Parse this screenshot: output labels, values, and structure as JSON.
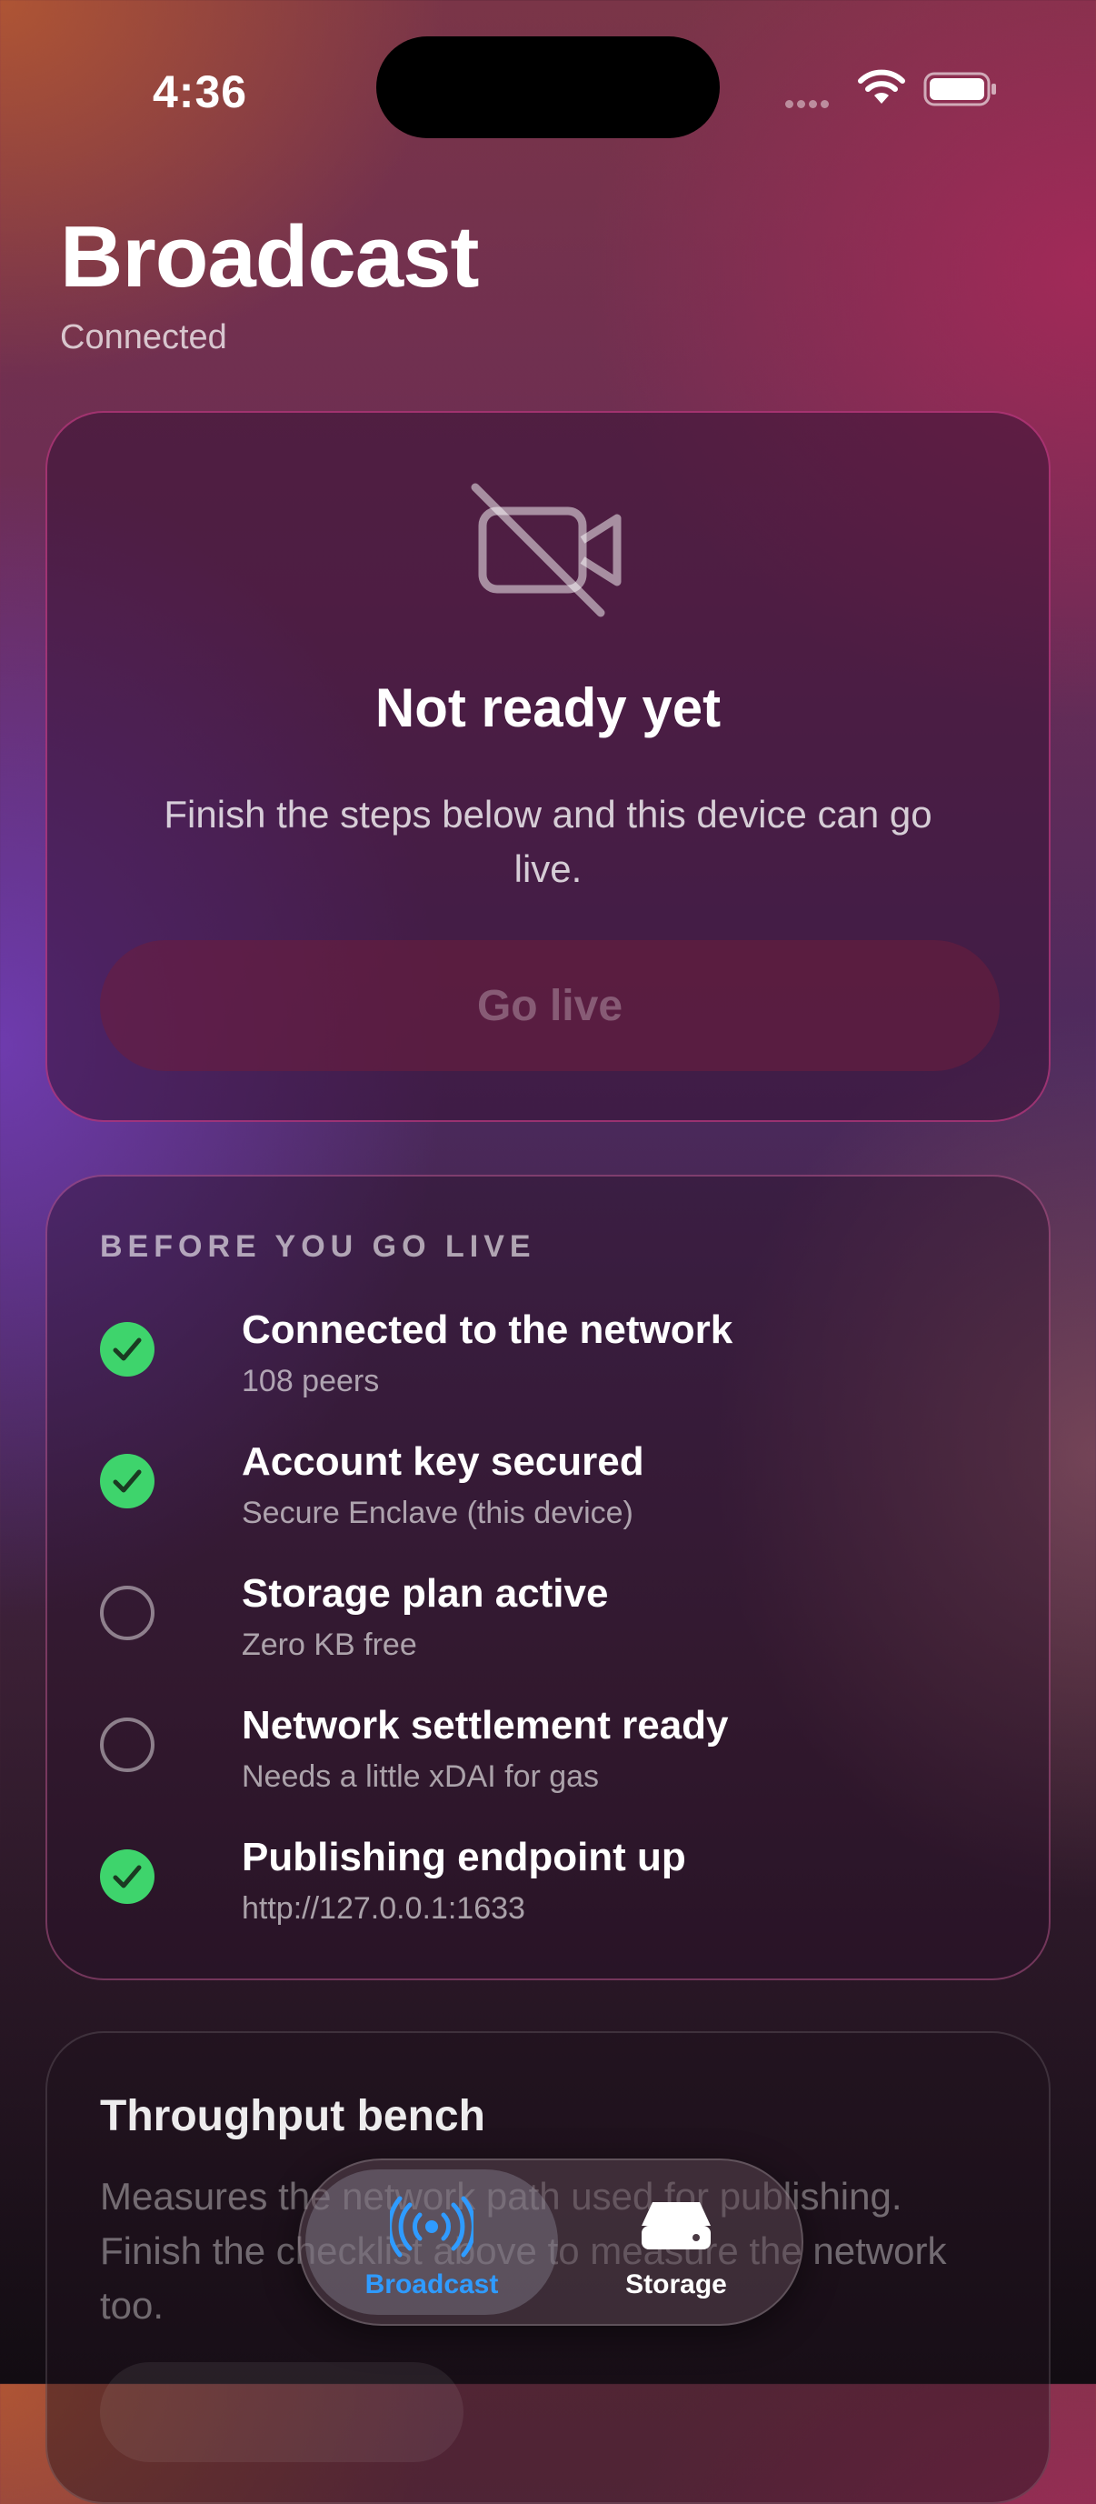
{
  "status_bar": {
    "time": "4:36"
  },
  "header": {
    "title": "Broadcast",
    "status": "Connected"
  },
  "hero": {
    "icon": "video-off-icon",
    "title": "Not ready yet",
    "description": "Finish the steps below and this device can go live.",
    "button_label": "Go live"
  },
  "checklist": {
    "section_label": "BEFORE YOU GO LIVE",
    "items": [
      {
        "title": "Connected to the network",
        "subtitle": "108 peers",
        "done": true
      },
      {
        "title": "Account key secured",
        "subtitle": "Secure Enclave (this device)",
        "done": true
      },
      {
        "title": "Storage plan active",
        "subtitle": "Zero KB free",
        "done": false
      },
      {
        "title": "Network settlement ready",
        "subtitle": "Needs a little xDAI for gas",
        "done": false
      },
      {
        "title": "Publishing endpoint up",
        "subtitle": "http://127.0.0.1:1633",
        "done": true
      }
    ]
  },
  "bench": {
    "title": "Throughput bench",
    "description": "Measures the network path used for publishing. Finish the checklist above to measure the network too."
  },
  "tabbar": {
    "tabs": [
      {
        "label": "Broadcast",
        "icon": "broadcast-icon",
        "active": true
      },
      {
        "label": "Storage",
        "icon": "storage-drive-icon",
        "active": false
      }
    ]
  },
  "colors": {
    "accent": "#2f9bff",
    "success": "#3ed46c"
  }
}
